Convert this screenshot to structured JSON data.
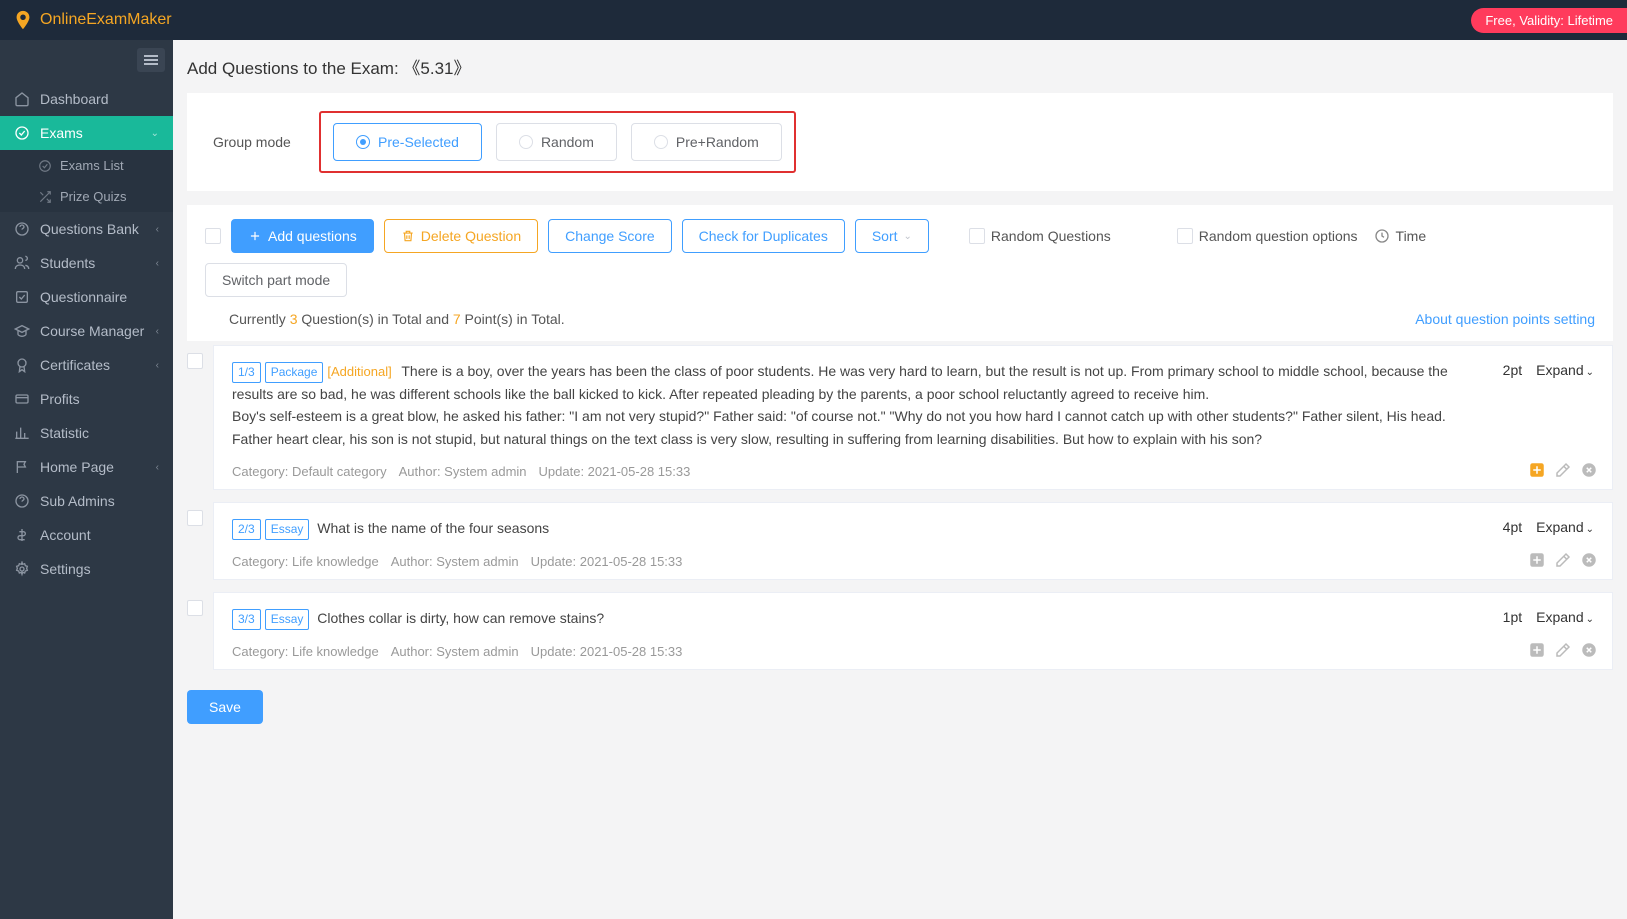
{
  "brand": "OnlineExamMaker",
  "validity": "Free, Validity: Lifetime",
  "nav": {
    "dashboard": "Dashboard",
    "exams": "Exams",
    "exams_list": "Exams List",
    "prize_quizs": "Prize Quizs",
    "questions_bank": "Questions Bank",
    "students": "Students",
    "questionnaire": "Questionnaire",
    "course_manager": "Course Manager",
    "certificates": "Certificates",
    "profits": "Profits",
    "statistic": "Statistic",
    "home_page": "Home Page",
    "sub_admins": "Sub Admins",
    "account": "Account",
    "settings": "Settings"
  },
  "page": {
    "title_prefix": "Add Questions to the Exam: ",
    "exam_name": "《5.31》"
  },
  "group_mode": {
    "label": "Group mode",
    "pre_selected": "Pre-Selected",
    "random": "Random",
    "pre_random": "Pre+Random"
  },
  "toolbar": {
    "add_questions": "Add questions",
    "delete_question": "Delete Question",
    "change_score": "Change Score",
    "check_duplicates": "Check for Duplicates",
    "sort": "Sort",
    "random_questions": "Random Questions",
    "random_options": "Random question options",
    "time": "Time",
    "switch_part": "Switch part mode"
  },
  "summary": {
    "prefix": "Currently ",
    "count": "3",
    "mid1": " Question(s) in Total and ",
    "points": "7",
    "suffix": " Point(s) in Total.",
    "link": "About question points setting"
  },
  "questions": [
    {
      "index": "1/3",
      "type": "Package",
      "additional": "[Additional]",
      "text": "There is a boy, over the years has been the class of poor students. He was very hard to learn, but the result is not up. From primary school to middle school, because the results are so bad, he was different schools like the ball kicked to kick. After repeated pleading by the parents, a poor school reluctantly agreed to receive him.\nBoy's self-esteem is a great blow, he asked his father: \"I am not very stupid?\" Father said: \"of course not.\" \"Why do not you how hard I cannot catch up with other students?\" Father silent, His head.\nFather heart clear, his son is not stupid, but natural things on the text class is very slow, resulting in suffering from learning disabilities. But how to explain with his son?",
      "points": "2pt",
      "category": "Default category",
      "author": "System admin",
      "update": "2021-05-28 15:33",
      "action_highlight": true
    },
    {
      "index": "2/3",
      "type": "Essay",
      "additional": "",
      "text": "What is the name of the four seasons",
      "points": "4pt",
      "category": "Life knowledge",
      "author": "System admin",
      "update": "2021-05-28 15:33",
      "action_highlight": false
    },
    {
      "index": "3/3",
      "type": "Essay",
      "additional": "",
      "text": "Clothes collar is dirty, how can remove stains?",
      "points": "1pt",
      "category": "Life knowledge",
      "author": "System admin",
      "update": "2021-05-28 15:33",
      "action_highlight": false
    }
  ],
  "expand_label": "Expand",
  "meta_labels": {
    "category": "Category: ",
    "author": "Author: ",
    "update": "Update: "
  },
  "save": "Save"
}
